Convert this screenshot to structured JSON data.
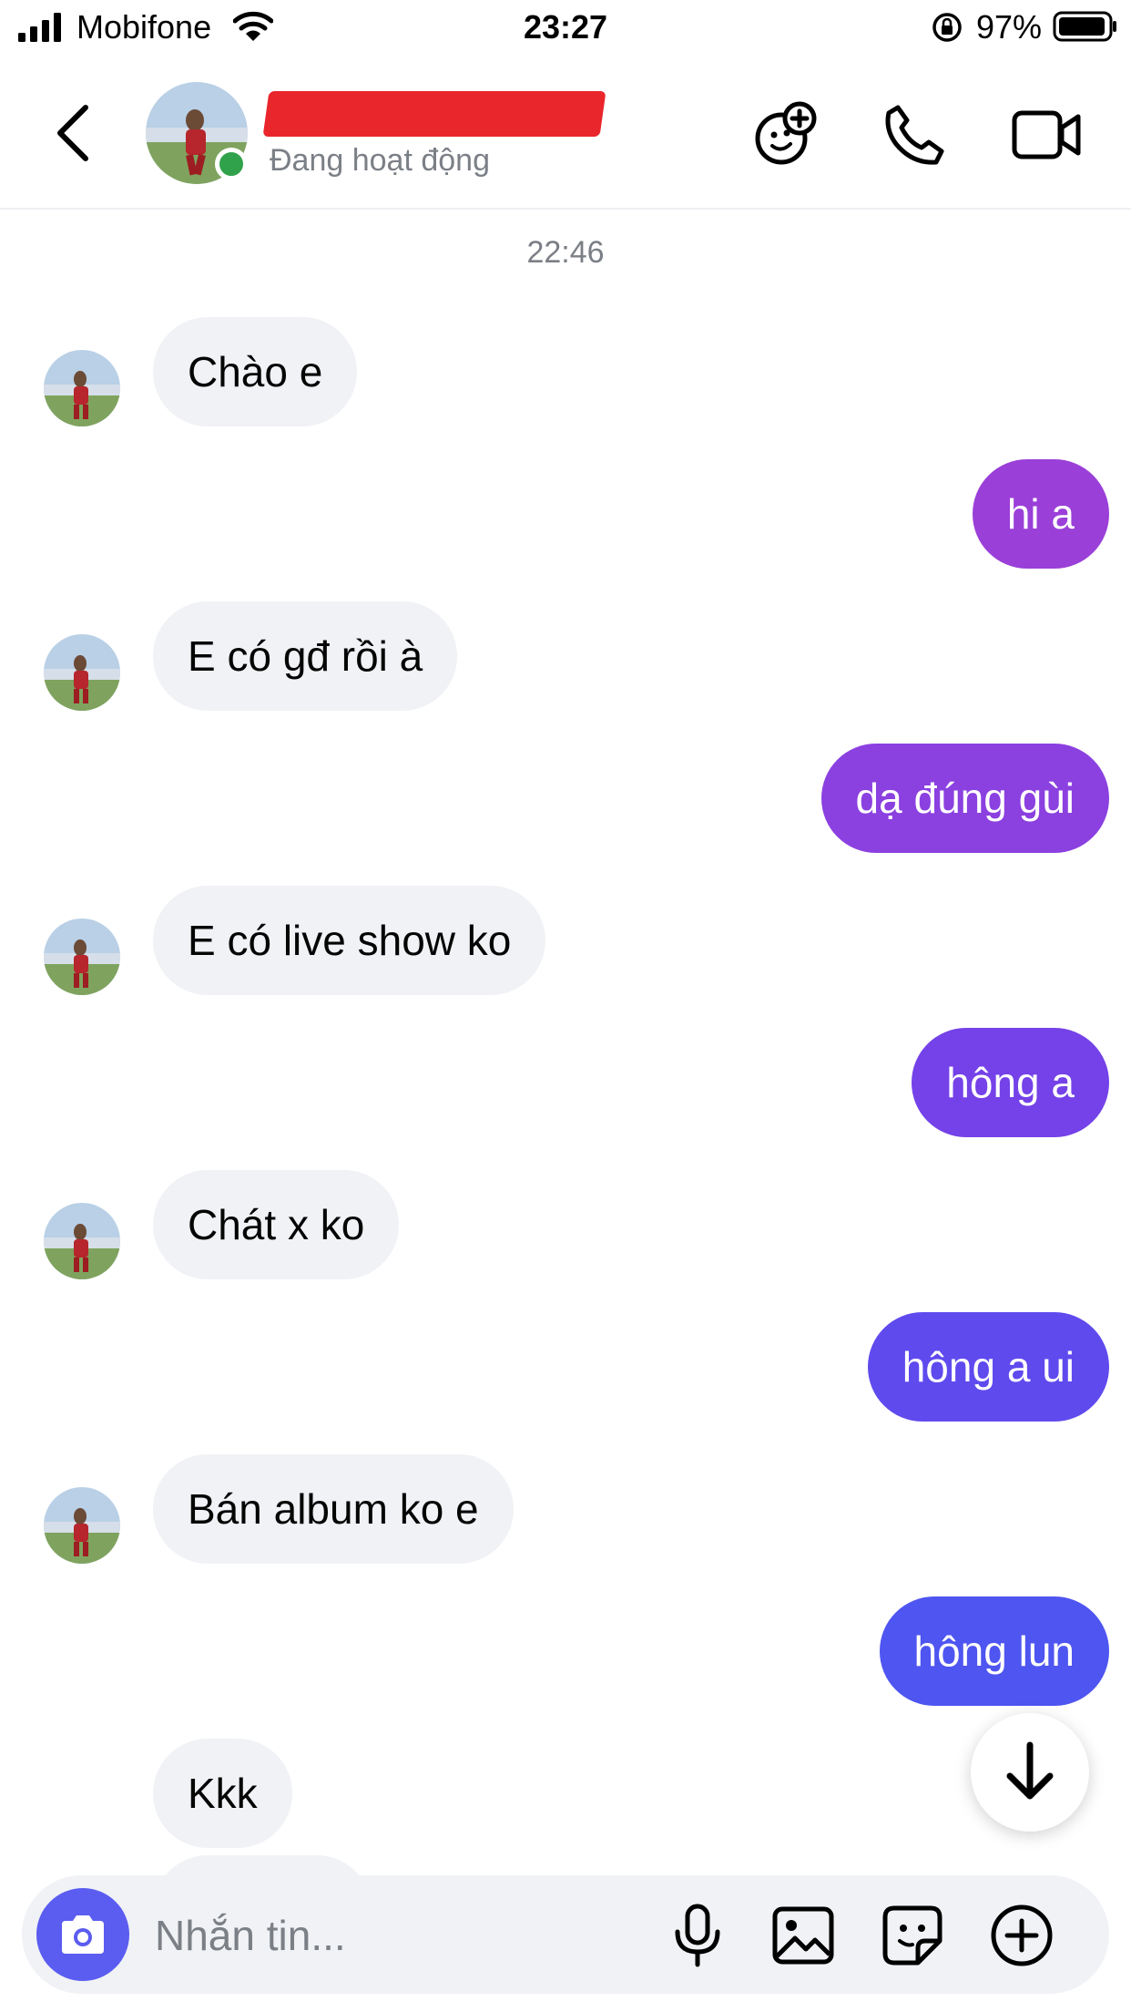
{
  "status_bar": {
    "carrier": "Mobifone",
    "time": "23:27",
    "battery_percent": "97%"
  },
  "header": {
    "contact_status": "Đang hoạt động",
    "online_color": "#31a24c"
  },
  "conversation": {
    "timestamp": "22:46",
    "incoming_color": "#f0f2f5",
    "outgoing_gradient": [
      "#9b3fd6",
      "#4a55f0"
    ],
    "messages": [
      {
        "direction": "in",
        "text": "Chào e"
      },
      {
        "direction": "out",
        "text": "hi a"
      },
      {
        "direction": "in",
        "text": "E có gđ rồi à"
      },
      {
        "direction": "out",
        "text": "dạ đúng gùi"
      },
      {
        "direction": "in",
        "text": "E có live show ko"
      },
      {
        "direction": "out",
        "text": "hông a"
      },
      {
        "direction": "in",
        "text": "Chát x ko"
      },
      {
        "direction": "out",
        "text": "hông a ui"
      },
      {
        "direction": "in",
        "text": "Bán album ko e"
      },
      {
        "direction": "out",
        "text": "hông lun"
      },
      {
        "direction": "in",
        "text": "Kkk"
      }
    ]
  },
  "composer": {
    "placeholder": "Nhắn tin...",
    "accent_color": "#5b5cf0"
  }
}
